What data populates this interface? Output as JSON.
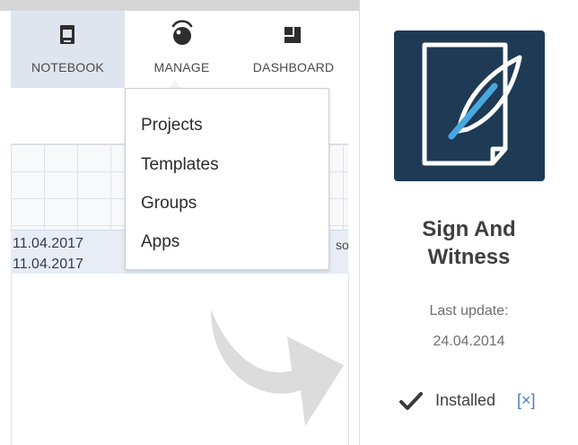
{
  "nav": {
    "tabs": [
      {
        "label": "NOTEBOOK",
        "icon": "notebook-icon"
      },
      {
        "label": "MANAGE",
        "icon": "manage-icon"
      },
      {
        "label": "DASHBOARD",
        "icon": "dashboard-icon"
      }
    ],
    "active_tab": "NOTEBOOK"
  },
  "manage_menu": {
    "items": [
      "Projects",
      "Templates",
      "Groups",
      "Apps"
    ]
  },
  "background": {
    "date_1": "11.04.2017",
    "date_2": "11.04.2017",
    "truncated_text": "so"
  },
  "app_detail": {
    "name_line1": "Sign And",
    "name_line2": "Witness",
    "last_update_label": "Last update:",
    "last_update_date": "24.04.2014",
    "status": "Installed",
    "uninstall_label": "[×]",
    "icon": "feather-pen-icon"
  },
  "colors": {
    "nav_active_bg": "#dfe5ee",
    "app_icon_bg": "#1e3a55",
    "accent_blue": "#4a7fc1",
    "feather_blue": "#4aa8e0"
  }
}
